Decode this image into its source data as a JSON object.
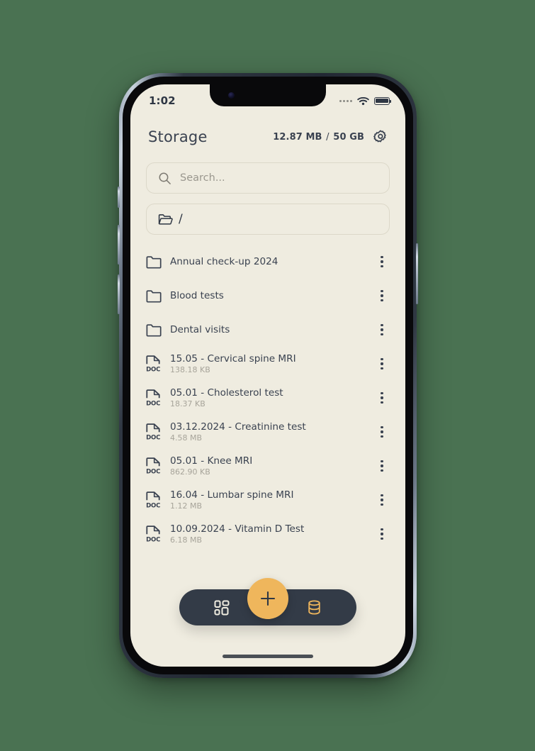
{
  "theme": {
    "page_background": "#4a7252",
    "screen_background": "#efece0",
    "text_primary": "#3a4250",
    "text_muted": "#a7a49a",
    "accent": "#efb65c",
    "nav_bar": "#333b47"
  },
  "status_bar": {
    "time": "1:02",
    "signal_icon": "signal-dots-icon",
    "wifi_icon": "wifi-icon",
    "battery_icon": "battery-full-icon"
  },
  "header": {
    "title": "Storage",
    "used": "12.87 MB",
    "separator": "/",
    "total": "50 GB",
    "settings_icon": "gear-icon"
  },
  "search": {
    "placeholder": "Search...",
    "value": "",
    "icon": "search-icon"
  },
  "breadcrumb": {
    "icon": "folder-open-icon",
    "path": "/"
  },
  "file_list": [
    {
      "type": "folder",
      "icon": "folder-icon",
      "name": "Annual check-up 2024",
      "size": ""
    },
    {
      "type": "folder",
      "icon": "folder-icon",
      "name": "Blood tests",
      "size": ""
    },
    {
      "type": "folder",
      "icon": "folder-icon",
      "name": "Dental visits",
      "size": ""
    },
    {
      "type": "file",
      "icon": "document-icon",
      "name": "15.05 - Cervical spine MRI",
      "size": "138.18 KB"
    },
    {
      "type": "file",
      "icon": "document-icon",
      "name": "05.01 - Cholesterol test",
      "size": "18.37 KB"
    },
    {
      "type": "file",
      "icon": "document-icon",
      "name": "03.12.2024 - Creatinine test",
      "size": "4.58 MB"
    },
    {
      "type": "file",
      "icon": "document-icon",
      "name": "05.01 - Knee MRI",
      "size": "862.90 KB"
    },
    {
      "type": "file",
      "icon": "document-icon",
      "name": "16.04 - Lumbar spine MRI",
      "size": "1.12 MB"
    },
    {
      "type": "file",
      "icon": "document-icon",
      "name": "10.09.2024 - Vitamin D Test",
      "size": "6.18 MB"
    }
  ],
  "row_menu": {
    "icon": "more-vertical-icon",
    "label": ""
  },
  "bottom_nav": {
    "left_icon": "grid-apps-icon",
    "fab_icon": "plus-icon",
    "right_icon": "database-icon"
  },
  "doc_icon_label": "DOC"
}
